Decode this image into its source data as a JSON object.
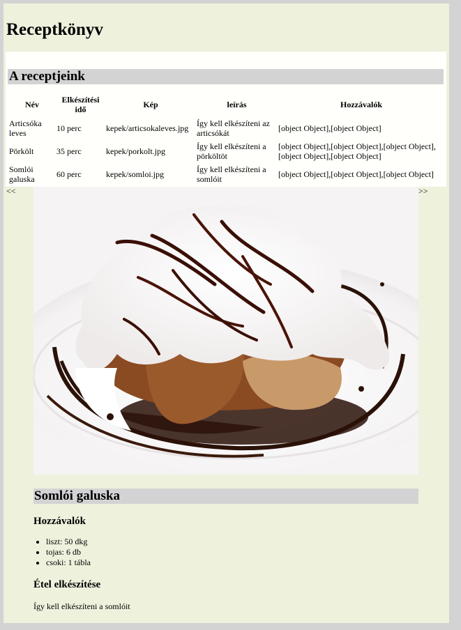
{
  "page": {
    "title": "Receptkönyv"
  },
  "recipes_section": {
    "heading": "A receptjeink",
    "columns": [
      "Név",
      "Elkészítési idő",
      "Kép",
      "leírás",
      "Hozzávalók"
    ],
    "rows": [
      {
        "name": "Articsóka leves",
        "time": "10 perc",
        "image": "kepek/articsokaleves.jpg",
        "description": "Így kell elkészíteni az articsókát",
        "ingredients": "[object Object],[object Object]"
      },
      {
        "name": "Pörkölt",
        "time": "35 perc",
        "image": "kepek/porkolt.jpg",
        "description": "Így kell elkészíteni a pörköltöt",
        "ingredients": "[object Object],[object Object],[object Object],[object Object],[object Object]"
      },
      {
        "name": "Somlói galuska",
        "time": "60 perc",
        "image": "kepek/somloi.jpg",
        "description": "Így kell elkészíteni a somlóit",
        "ingredients": "[object Object],[object Object],[object Object]"
      }
    ]
  },
  "navigation": {
    "prev_label": "<<",
    "next_label": ">>"
  },
  "selected_recipe": {
    "title": "Somlói galuska",
    "ingredients_heading": "Hozzávalók",
    "ingredients": [
      "liszt: 50 dkg",
      "tojas: 6 db",
      "csoki: 1 tábla"
    ],
    "preparation_heading": "Étel elkészítése",
    "preparation_text": "Így kell elkészíteni a somlóit"
  },
  "colors": {
    "page_background": "#eef1dc",
    "outer_background": "#d3d3d3",
    "heading_bar": "#d3d3d3",
    "table_panel": "#fffffb"
  }
}
